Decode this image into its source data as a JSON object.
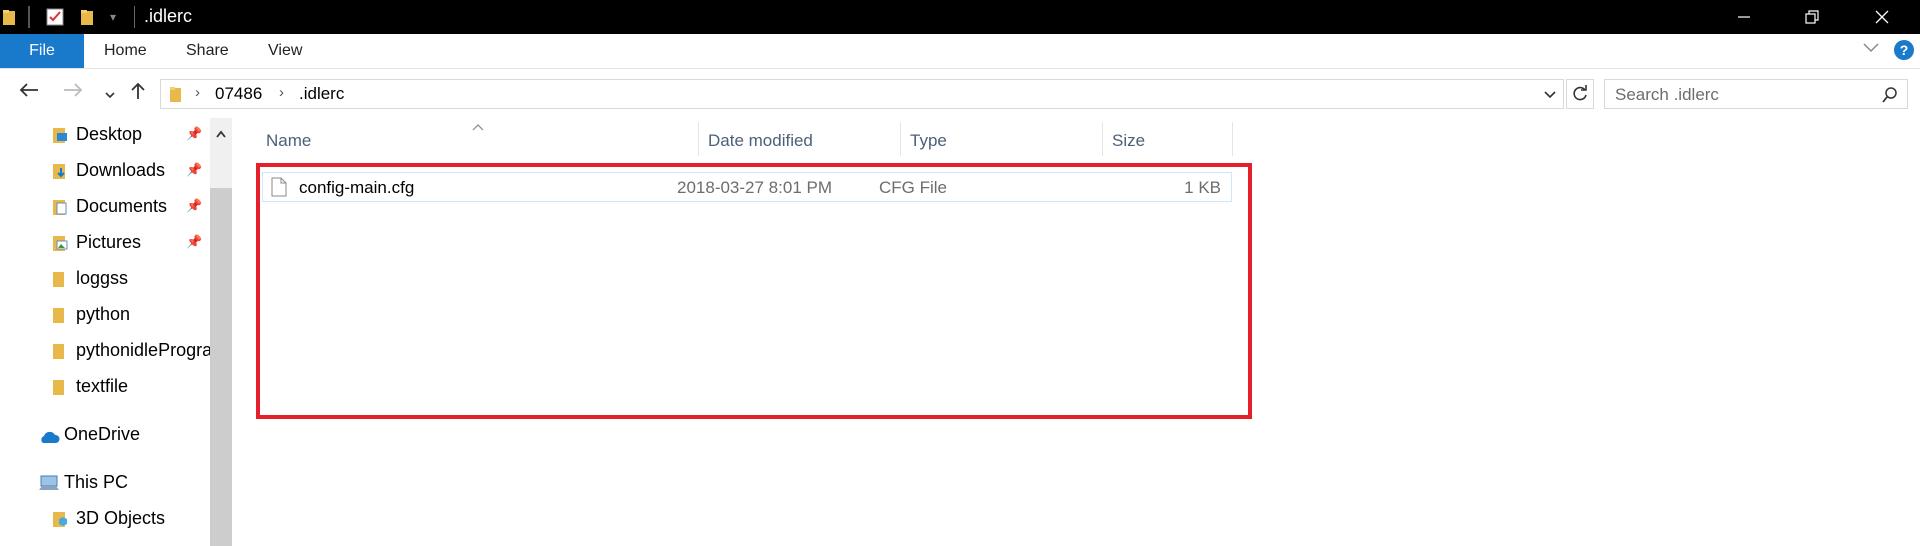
{
  "window": {
    "title": ".idlerc",
    "minimize_icon": "minimize-icon",
    "restore_icon": "restore-icon",
    "close_icon": "close-icon"
  },
  "ribbon": {
    "tabs": [
      "File",
      "Home",
      "Share",
      "View"
    ]
  },
  "address": {
    "crumbs": [
      "07486",
      ".idlerc"
    ]
  },
  "search": {
    "placeholder": "Search .idlerc"
  },
  "navpane": {
    "quick_access": [
      {
        "label": "Desktop",
        "icon": "desktop-folder-icon",
        "pinned": true
      },
      {
        "label": "Downloads",
        "icon": "downloads-folder-icon",
        "pinned": true
      },
      {
        "label": "Documents",
        "icon": "documents-folder-icon",
        "pinned": true
      },
      {
        "label": "Pictures",
        "icon": "pictures-folder-icon",
        "pinned": true
      },
      {
        "label": "loggss",
        "icon": "folder-icon",
        "pinned": false
      },
      {
        "label": "python",
        "icon": "folder-icon",
        "pinned": false
      },
      {
        "label": "pythonidleProgra",
        "icon": "folder-icon",
        "pinned": false
      },
      {
        "label": "textfile",
        "icon": "folder-icon",
        "pinned": false
      }
    ],
    "onedrive": "OneDrive",
    "this_pc": "This PC",
    "objects_3d": "3D Objects"
  },
  "columns": [
    "Name",
    "Date modified",
    "Type",
    "Size"
  ],
  "files": [
    {
      "name": "config-main.cfg",
      "date": "2018-03-27 8:01 PM",
      "type": "CFG File",
      "size": "1 KB"
    }
  ],
  "colors": {
    "accent": "#1979ca",
    "highlight": "#e4202a",
    "selection_border": "#cce8ff"
  }
}
